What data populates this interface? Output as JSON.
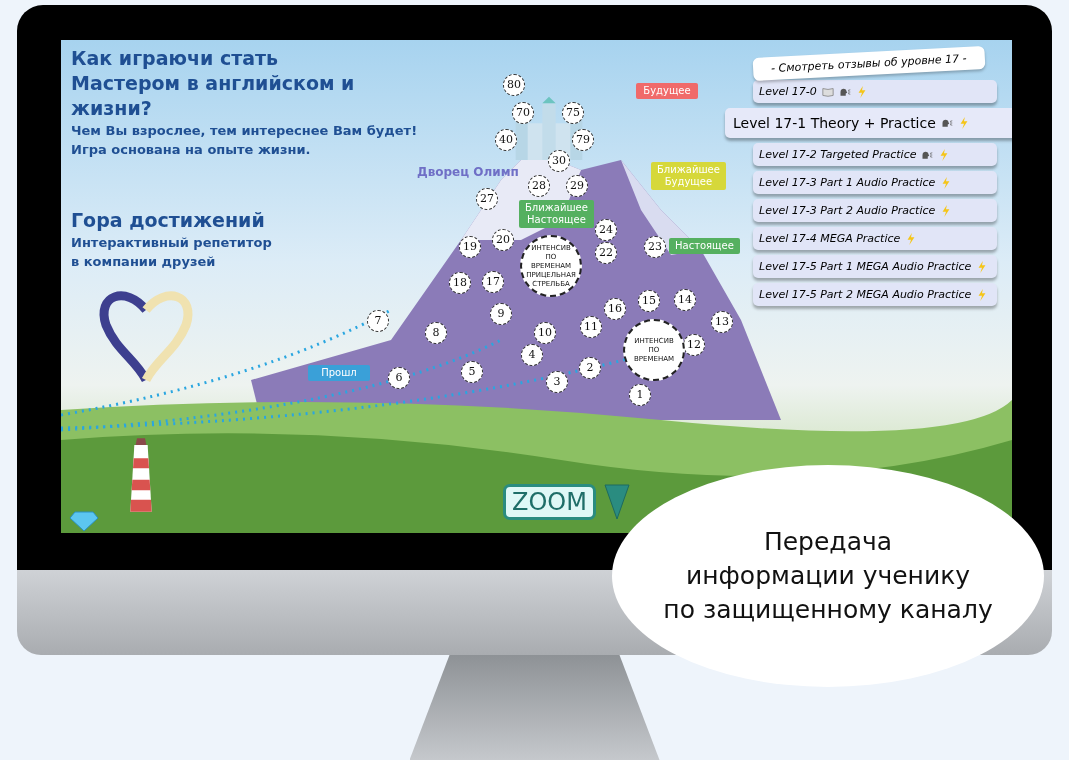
{
  "intro": {
    "title": "Как играючи стать Мастером в английском и жизни?",
    "lines": [
      "Чем Вы взрослее, тем интереснее Вам будет!",
      "Игра основана на опыте жизни."
    ]
  },
  "section": {
    "title": "Гора достижений",
    "lines": [
      "Интерактивный репетитор",
      "в компании друзей"
    ]
  },
  "castle_label": "Дворец Олимп",
  "flags": [
    {
      "label": "Будущее",
      "color": "#f06a6a"
    },
    {
      "label": "Ближайшее Будущее",
      "color": "#d6d83a"
    },
    {
      "label": "Ближайшее Настоящее",
      "color": "#55b060"
    },
    {
      "label": "Настоящее",
      "color": "#55b060"
    },
    {
      "label": "Прошл",
      "color": "#3aa0d8"
    }
  ],
  "nodes": [
    "80",
    "70",
    "75",
    "40",
    "79",
    "30",
    "28",
    "29",
    "27",
    "24",
    "20",
    "19",
    "22",
    "23",
    "18",
    "17",
    "16",
    "15",
    "14",
    "9",
    "7",
    "8",
    "10",
    "11",
    "12",
    "13",
    "4",
    "2",
    "5",
    "6",
    "3",
    "1"
  ],
  "intensives": [
    "ИНТЕНСИВ ПО ВРЕМЕНАМ ПРИЦЕЛЬНАЯ СТРЕЛЬБА",
    "ИНТЕНСИВ ПО ВРЕМЕНАМ"
  ],
  "reviews_link": "- Смотреть отзывы об уровне 17 -",
  "levels": [
    {
      "label": "Level 17-0",
      "book": true,
      "voice": true,
      "selected": false
    },
    {
      "label": "Level 17-1 Theory + Practice",
      "book": false,
      "voice": true,
      "selected": true
    },
    {
      "label": "Level 17-2 Targeted Practice",
      "book": false,
      "voice": true,
      "selected": false
    },
    {
      "label": "Level 17-3 Part 1 Audio Practice",
      "book": false,
      "voice": false,
      "selected": false
    },
    {
      "label": "Level 17-3 Part 2 Audio Practice",
      "book": false,
      "voice": false,
      "selected": false
    },
    {
      "label": "Level 17-4 MEGA Practice",
      "book": false,
      "voice": false,
      "selected": false
    },
    {
      "label": "Level 17-5 Part 1 MEGA Audio Practice",
      "book": false,
      "voice": false,
      "selected": false
    },
    {
      "label": "Level 17-5 Part 2 MEGA Audio Practice",
      "book": false,
      "voice": false,
      "selected": false
    }
  ],
  "zoom_button": "ZOOM",
  "callout": [
    "Передача",
    "информации ученику",
    "по защищенному каналу"
  ]
}
